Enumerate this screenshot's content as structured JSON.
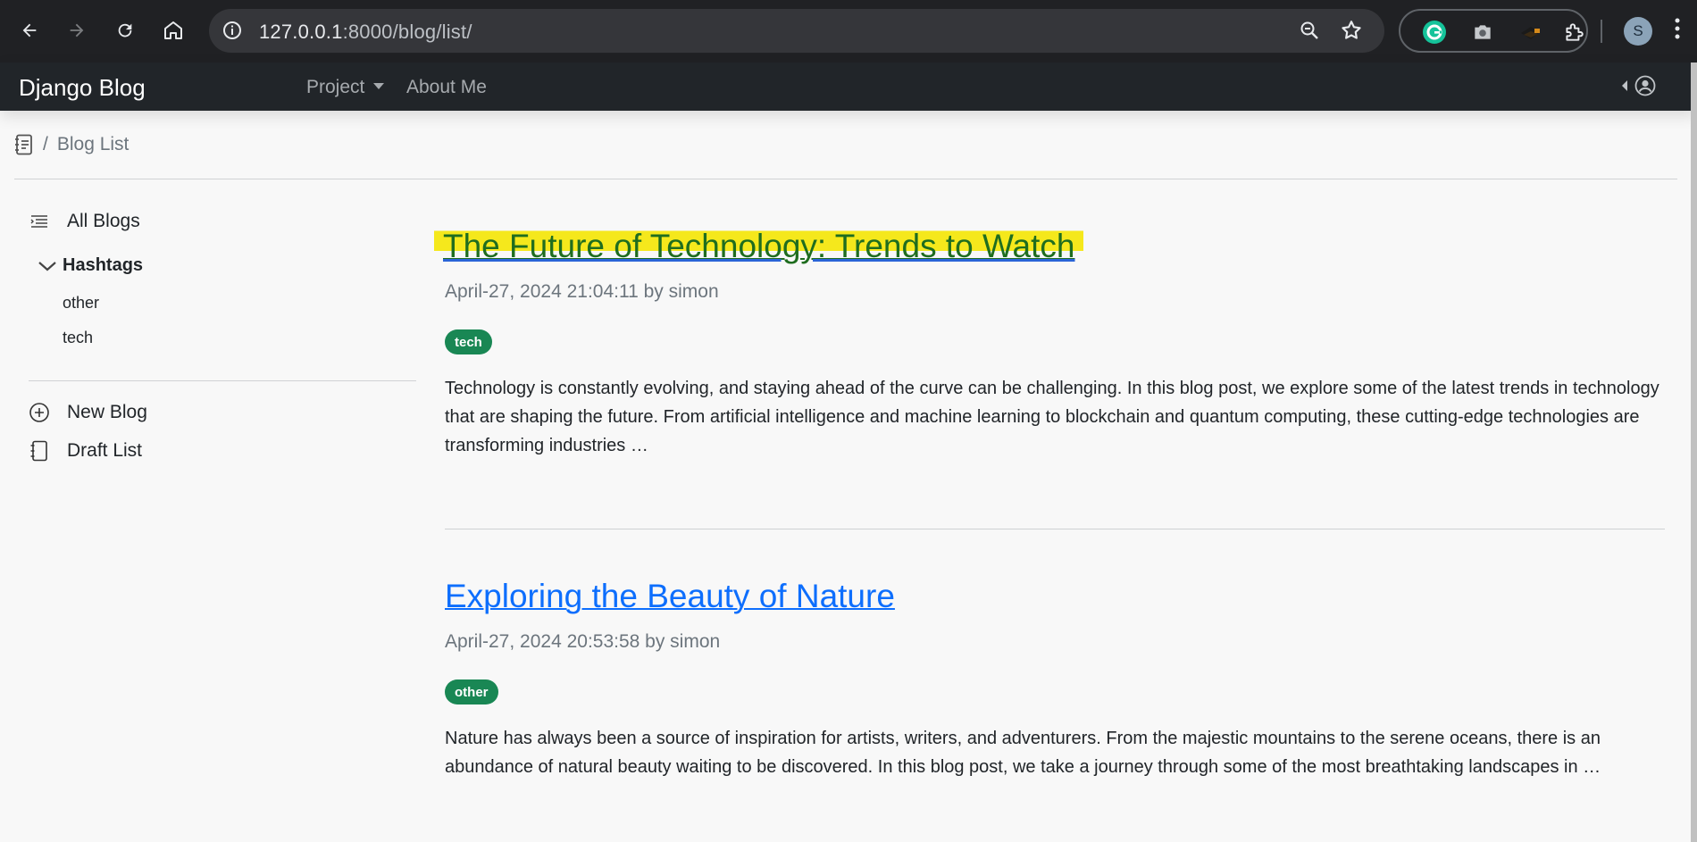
{
  "browser": {
    "url_host": "127.0.0.1",
    "url_rest": ":8000/blog/list/",
    "profile_initial": "S"
  },
  "navbar": {
    "brand": "Django Blog",
    "project_label": "Project",
    "about_label": "About Me"
  },
  "breadcrumb": {
    "separator": "/",
    "current": "Blog List"
  },
  "sidebar": {
    "all_blogs": "All Blogs",
    "hashtags_title": "Hashtags",
    "hashtags": [
      "other",
      "tech"
    ],
    "new_blog": "New Blog",
    "draft_list": "Draft List"
  },
  "posts": [
    {
      "title": "The Future of Technology: Trends to Watch",
      "meta": "April-27, 2024 21:04:11 by simon",
      "tag": "tech",
      "excerpt": "Technology is constantly evolving, and staying ahead of the curve can be challenging. In this blog post, we explore some of the latest trends in technology that are shaping the future. From artificial intelligence and machine learning to blockchain and quantum computing, these cutting-edge technologies are transforming industries …"
    },
    {
      "title": "Exploring the Beauty of Nature",
      "meta": "April-27, 2024 20:53:58 by simon",
      "tag": "other",
      "excerpt": "Nature has always been a source of inspiration for artists, writers, and adventurers. From the majestic mountains to the serene oceans, there is an abundance of natural beauty waiting to be discovered. In this blog post, we take a journey through some of the most breathtaking landscapes in …"
    }
  ],
  "colors": {
    "navbar_bg": "#212529",
    "link": "#0d6efd",
    "badge": "#198754",
    "highlight": "#f5e81c"
  }
}
